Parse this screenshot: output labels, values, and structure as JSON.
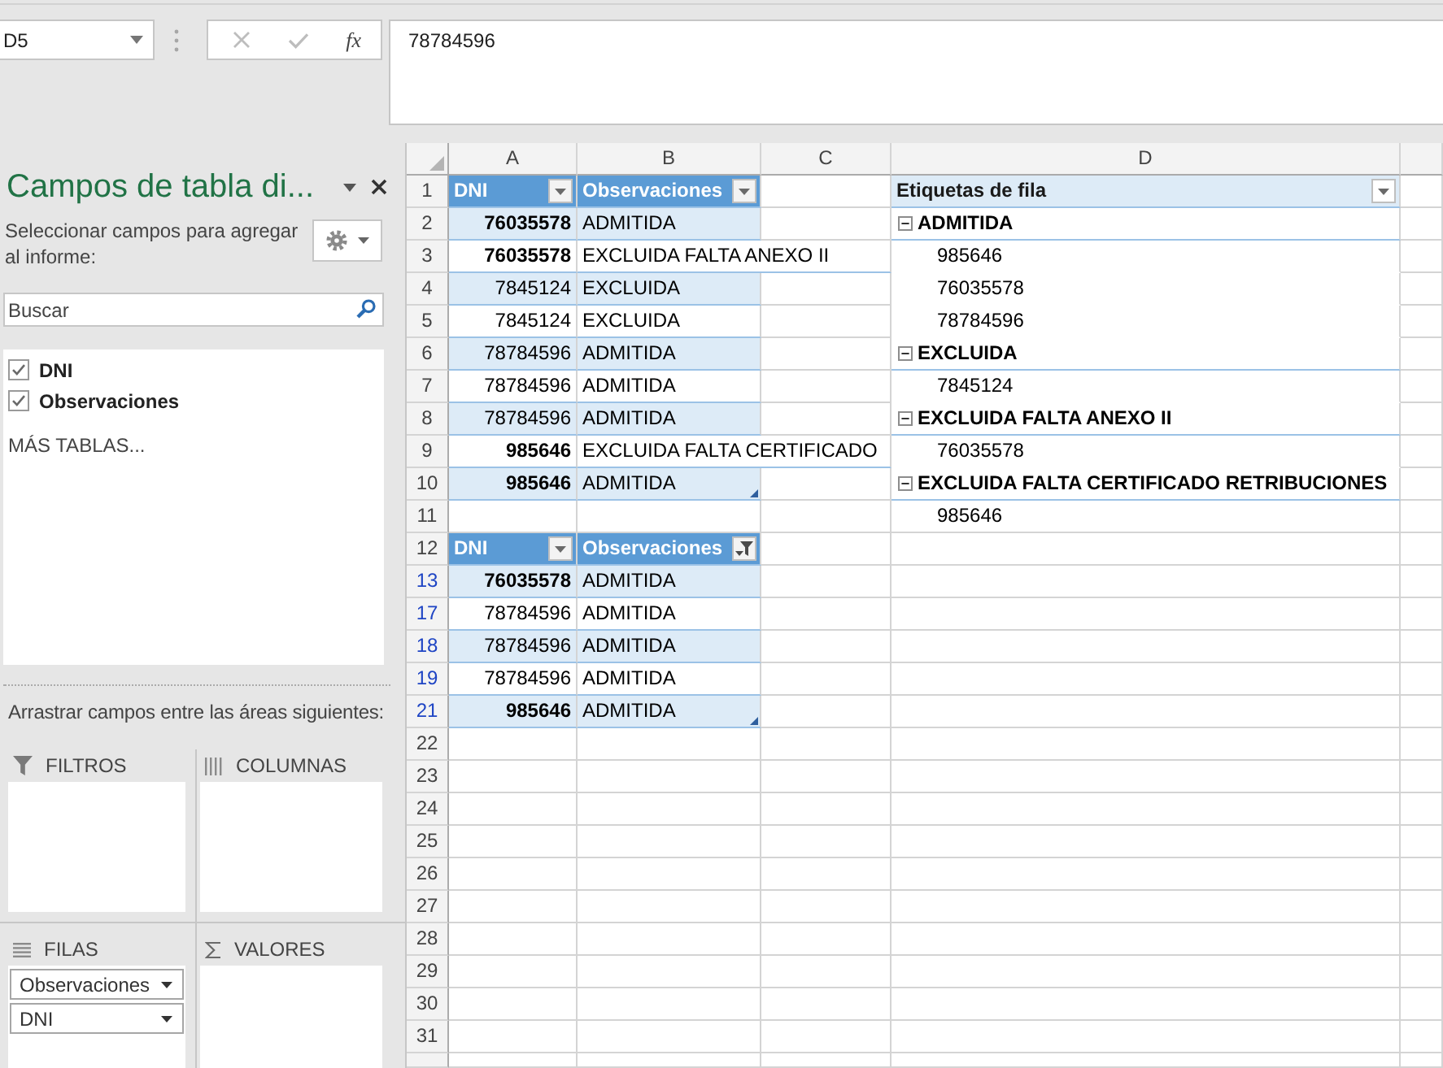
{
  "formula_bar": {
    "name_box": "D5",
    "cancel": {
      "disabled": true
    },
    "enter": {
      "disabled": true
    },
    "function_label": "fx",
    "formula": "78784596"
  },
  "field_panel": {
    "title": "Campos de tabla di...",
    "instruction": "Seleccionar campos para agregar al informe:",
    "search": {
      "placeholder": "Buscar"
    },
    "fields": [
      {
        "label": "DNI",
        "checked": true
      },
      {
        "label": "Observaciones",
        "checked": true
      }
    ],
    "more_tables": "MÁS TABLAS...",
    "areas_hint": "Arrastrar campos entre las áreas siguientes:",
    "areas": [
      {
        "kind": "filters",
        "label": "FILTROS"
      },
      {
        "kind": "columns",
        "label": "COLUMNAS"
      },
      {
        "kind": "rows",
        "label": "FILAS",
        "items": [
          "Observaciones",
          "DNI"
        ]
      },
      {
        "kind": "values",
        "label": "VALORES"
      }
    ]
  },
  "sheet": {
    "columns": [
      "A",
      "B",
      "C",
      "D"
    ],
    "rows": [
      {
        "number": "1",
        "filtered": false,
        "cells": [
          {
            "kind": "header",
            "text": "DNI",
            "filter_applied": false
          },
          {
            "kind": "header",
            "text": "Observaciones",
            "filter_applied": false
          }
        ]
      },
      {
        "number": "2",
        "filtered": false,
        "cells": [
          {
            "kind": "number",
            "text": "76035578",
            "bold": true,
            "banded": true
          },
          {
            "kind": "text",
            "text": "ADMITIDA",
            "banded": true
          }
        ]
      },
      {
        "number": "3",
        "filtered": false,
        "cells": [
          {
            "kind": "number",
            "text": "76035578",
            "bold": true,
            "banded": false
          },
          {
            "kind": "text",
            "text": "EXCLUIDA FALTA ANEXO II",
            "banded": false
          }
        ]
      },
      {
        "number": "4",
        "filtered": false,
        "cells": [
          {
            "kind": "number",
            "text": "7845124",
            "bold": false,
            "banded": true
          },
          {
            "kind": "text",
            "text": "EXCLUIDA",
            "banded": true
          }
        ]
      },
      {
        "number": "5",
        "filtered": false,
        "cells": [
          {
            "kind": "number",
            "text": "7845124",
            "bold": false,
            "banded": false
          },
          {
            "kind": "text",
            "text": "EXCLUIDA",
            "banded": false
          }
        ]
      },
      {
        "number": "6",
        "filtered": false,
        "cells": [
          {
            "kind": "number",
            "text": "78784596",
            "bold": false,
            "banded": true
          },
          {
            "kind": "text",
            "text": "ADMITIDA",
            "banded": true
          }
        ]
      },
      {
        "number": "7",
        "filtered": false,
        "cells": [
          {
            "kind": "number",
            "text": "78784596",
            "bold": false,
            "banded": false
          },
          {
            "kind": "text",
            "text": "ADMITIDA",
            "banded": false
          }
        ]
      },
      {
        "number": "8",
        "filtered": false,
        "cells": [
          {
            "kind": "number",
            "text": "78784596",
            "bold": false,
            "banded": true
          },
          {
            "kind": "text",
            "text": "ADMITIDA",
            "banded": true
          }
        ]
      },
      {
        "number": "9",
        "filtered": false,
        "cells": [
          {
            "kind": "number",
            "text": "985646",
            "bold": true,
            "banded": false
          },
          {
            "kind": "text",
            "text": "EXCLUIDA FALTA CERTIFICADO",
            "banded": false
          }
        ]
      },
      {
        "number": "10",
        "filtered": false,
        "cells": [
          {
            "kind": "number",
            "text": "985646",
            "bold": true,
            "banded": true
          },
          {
            "kind": "text",
            "text": "ADMITIDA",
            "banded": true,
            "resize_handle": true
          }
        ]
      },
      {
        "number": "11",
        "filtered": false
      },
      {
        "number": "12",
        "filtered": false,
        "cells": [
          {
            "kind": "header",
            "text": "DNI",
            "filter_applied": false
          },
          {
            "kind": "header",
            "text": "Observaciones",
            "filter_applied": true
          }
        ]
      },
      {
        "number": "13",
        "filtered": true,
        "cells": [
          {
            "kind": "number",
            "text": "76035578",
            "bold": true,
            "banded": true
          },
          {
            "kind": "text",
            "text": "ADMITIDA",
            "banded": true
          }
        ]
      },
      {
        "number": "17",
        "filtered": true,
        "cells": [
          {
            "kind": "number",
            "text": "78784596",
            "bold": false,
            "banded": false
          },
          {
            "kind": "text",
            "text": "ADMITIDA",
            "banded": false
          }
        ]
      },
      {
        "number": "18",
        "filtered": true,
        "cells": [
          {
            "kind": "number",
            "text": "78784596",
            "bold": false,
            "banded": true
          },
          {
            "kind": "text",
            "text": "ADMITIDA",
            "banded": true
          }
        ]
      },
      {
        "number": "19",
        "filtered": true,
        "cells": [
          {
            "kind": "number",
            "text": "78784596",
            "bold": false,
            "banded": false
          },
          {
            "kind": "text",
            "text": "ADMITIDA",
            "banded": false
          }
        ]
      },
      {
        "number": "21",
        "filtered": true,
        "cells": [
          {
            "kind": "number",
            "text": "985646",
            "bold": true,
            "banded": true
          },
          {
            "kind": "text",
            "text": "ADMITIDA",
            "banded": true,
            "resize_handle": true
          }
        ]
      },
      {
        "number": "22",
        "filtered": false
      },
      {
        "number": "23",
        "filtered": false
      },
      {
        "number": "24",
        "filtered": false
      },
      {
        "number": "25",
        "filtered": false
      },
      {
        "number": "26",
        "filtered": false
      },
      {
        "number": "27",
        "filtered": false
      },
      {
        "number": "28",
        "filtered": false
      },
      {
        "number": "29",
        "filtered": false
      },
      {
        "number": "30",
        "filtered": false
      },
      {
        "number": "31",
        "filtered": false
      }
    ],
    "pivot_table": {
      "header": "Etiquetas de fila",
      "groups": [
        {
          "label": "ADMITIDA",
          "expanded": true,
          "children": [
            {
              "label": "985646"
            },
            {
              "label": "76035578"
            },
            {
              "label": "78784596"
            }
          ]
        },
        {
          "label": "EXCLUIDA",
          "expanded": true,
          "children": [
            {
              "label": "7845124"
            }
          ]
        },
        {
          "label": "EXCLUIDA FALTA ANEXO II",
          "expanded": true,
          "children": [
            {
              "label": "76035578"
            }
          ]
        },
        {
          "label": "EXCLUIDA FALTA CERTIFICADO RETRIBUCIONES",
          "expanded": true,
          "children": [
            {
              "label": "985646"
            }
          ]
        }
      ]
    }
  }
}
